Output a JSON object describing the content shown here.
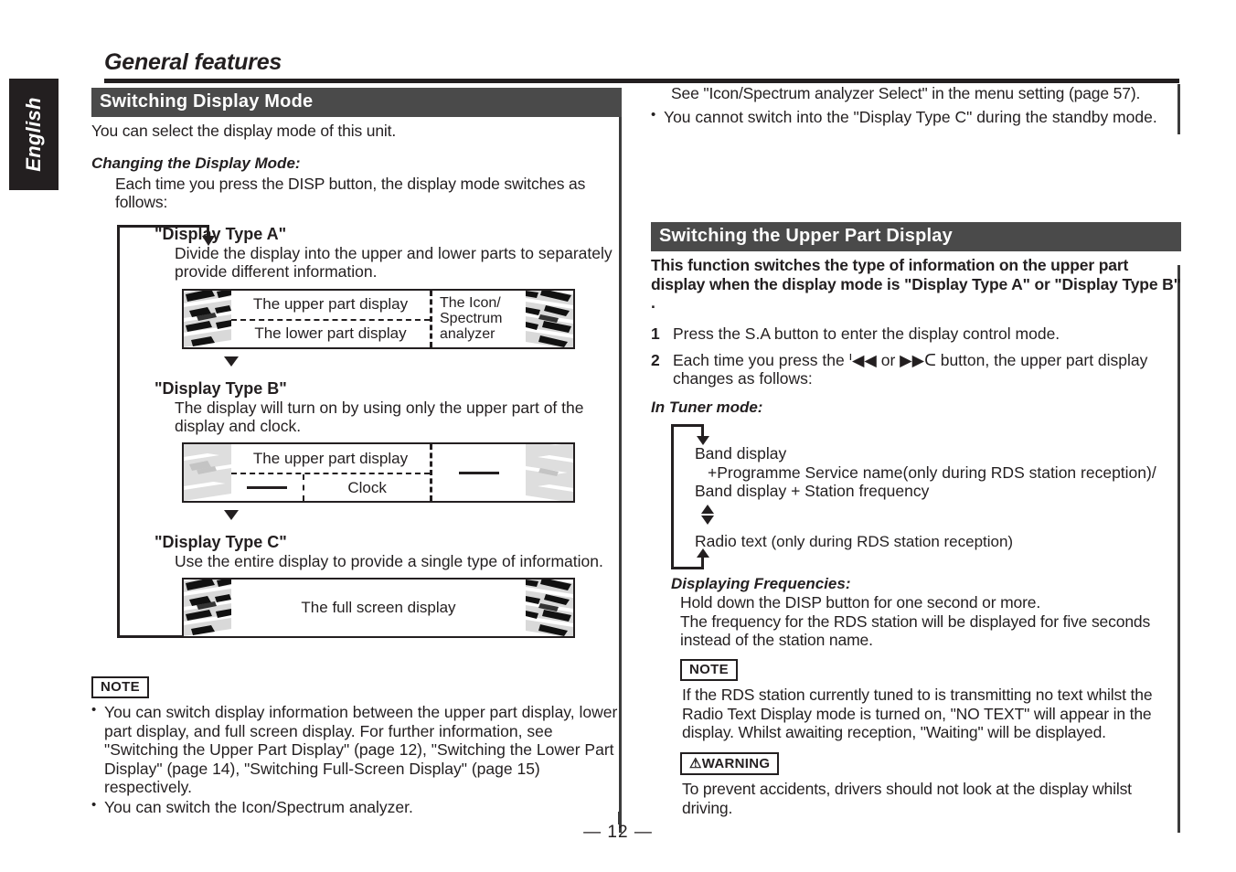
{
  "page": {
    "language_tab": "English",
    "running_head": "General features",
    "page_number": "— 12 —"
  },
  "left_column": {
    "section_title": "Switching Display Mode",
    "intro": "You can select the display mode of this unit.",
    "subhead": "Changing the Display Mode:",
    "subhead_body": "Each time you press the DISP button, the display mode switches as follows:",
    "types": [
      {
        "title": "\"Display Type A\"",
        "desc": "Divide the display into the upper and lower parts to separately provide different information.",
        "panel": {
          "upper": "The upper part display",
          "lower": "The lower part display",
          "right": "The Icon/\nSpectrum\nanalyzer"
        }
      },
      {
        "title": "\"Display Type B\"",
        "desc": "The display will turn on by using only the upper part of the display and clock.",
        "panel": {
          "upper": "The upper part display",
          "clock": "Clock"
        }
      },
      {
        "title": "\"Display Type C\"",
        "desc": "Use the entire display to provide a single type of information.",
        "panel": {
          "full": "The full screen display"
        }
      }
    ],
    "note_label": "NOTE",
    "notes": [
      "You can switch display information between the upper part display, lower part display, and full screen display. For further information, see \"Switching the Upper Part Display\" (page 12), \"Switching the Lower Part Display\" (page 14), \"Switching Full-Screen Display\" (page 15) respectively.",
      "You can switch the Icon/Spectrum analyzer."
    ]
  },
  "right_column": {
    "continued_note": "See \"Icon/Spectrum analyzer Select\" in the menu setting (page 57).",
    "continued_bullet": "You cannot switch into the \"Display Type C\" during the standby mode.",
    "section_title": "Switching the Upper Part Display",
    "intro": "This function switches the type of information on the upper part display when the display mode is \"Display Type A\" or \"Display Type B\" .",
    "steps": [
      {
        "num": "1",
        "text": "Press the S.A button to enter the display control mode."
      },
      {
        "num": "2",
        "text": "Each time you press the ᑊ◀◀ or ▶▶ᑕ button, the upper part display changes as follows:"
      }
    ],
    "tuner_subhead": "In Tuner mode:",
    "tuner_flow": {
      "line1": "Band display",
      "line2": "+Programme Service name(only during RDS station reception)/",
      "line3": "Band display + Station frequency",
      "line4_bold": "Radio text",
      "line4_rest": " (only during RDS station reception)"
    },
    "freq_subhead": "Displaying Frequencies:",
    "freq_body": "Hold down the DISP button for one second or more.\nThe frequency for the RDS station will be displayed for five seconds instead of the station name.",
    "note_label": "NOTE",
    "note_body": "If the RDS station currently tuned to is transmitting no text whilst the Radio Text Display mode is turned on, \"NO TEXT\" will appear in the display. Whilst awaiting reception, \"Waiting\" will be displayed.",
    "warning_label": "⚠WARNING",
    "warning_body": "To prevent accidents, drivers should not look at the display whilst driving."
  },
  "colors": {
    "ink": "#231f20",
    "section_bar": "#4a4a4a",
    "rule": "#3c3c3c"
  }
}
